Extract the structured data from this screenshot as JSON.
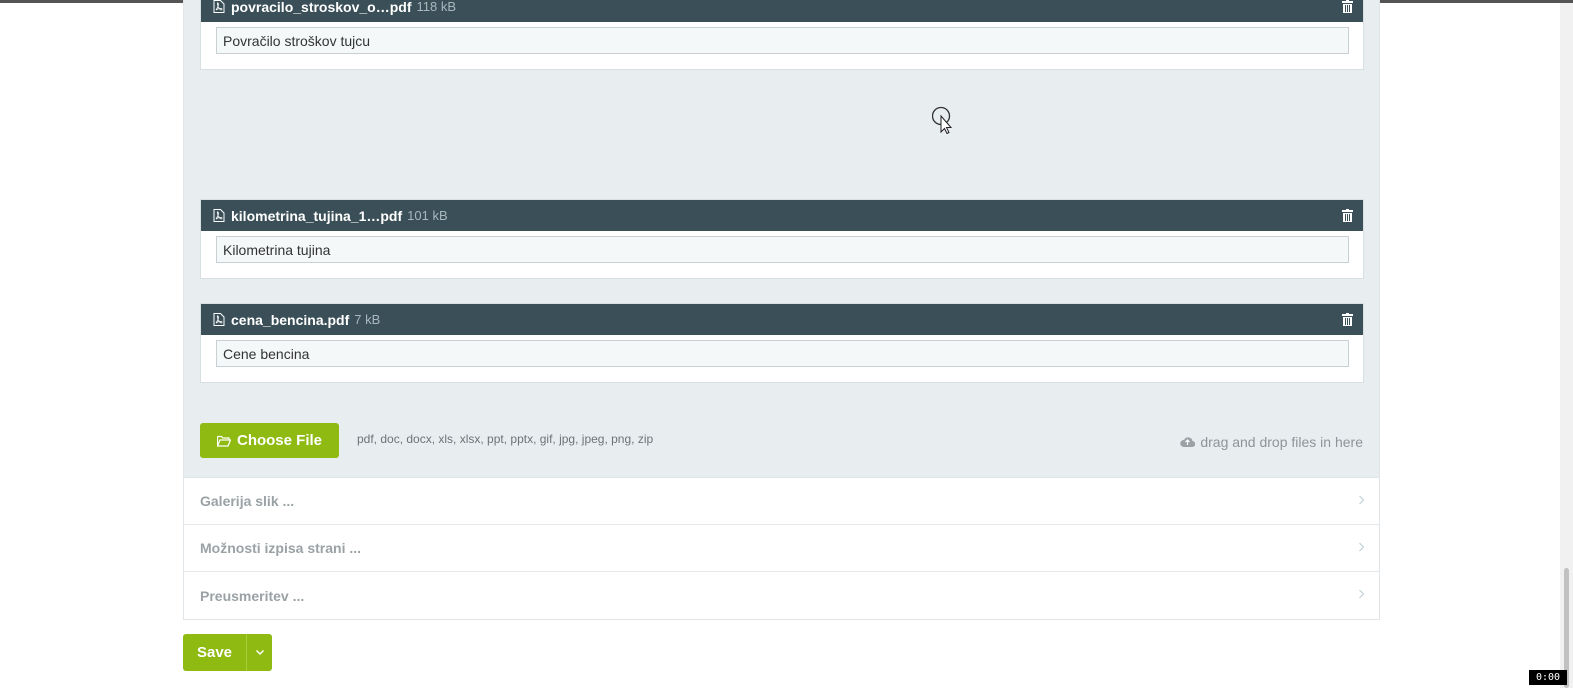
{
  "files": [
    {
      "name": "povracilo_stroskov_o…pdf",
      "size": "118 kB",
      "description": "Povračilo stroškov tujcu"
    },
    {
      "name": "kilometrina_tujina_1…pdf",
      "size": "101 kB",
      "description": "Kilometrina tujina"
    },
    {
      "name": "cena_bencina.pdf",
      "size": "7 kB",
      "description": "Cene bencina"
    }
  ],
  "upload": {
    "choose_label": "Choose File",
    "extensions": "pdf, doc, docx, xls, xlsx, ppt, pptx, gif, jpg, jpeg, png, zip",
    "drag_drop": "drag and drop files in here"
  },
  "accordion": [
    {
      "label": "Galerija slik ..."
    },
    {
      "label": "Možnosti izpisa strani ..."
    },
    {
      "label": "Preusmeritev ..."
    }
  ],
  "actions": {
    "save_label": "Save"
  },
  "timer": "0:00",
  "colors": {
    "accent": "#8fba11",
    "file_header": "#3a4f57",
    "panel_bg": "#e8edf0"
  },
  "icons": [
    "pdf-file-icon",
    "trash-icon",
    "folder-open-icon",
    "cloud-upload-icon",
    "chevron-right-icon",
    "chevron-down-icon",
    "cursor-icon"
  ]
}
